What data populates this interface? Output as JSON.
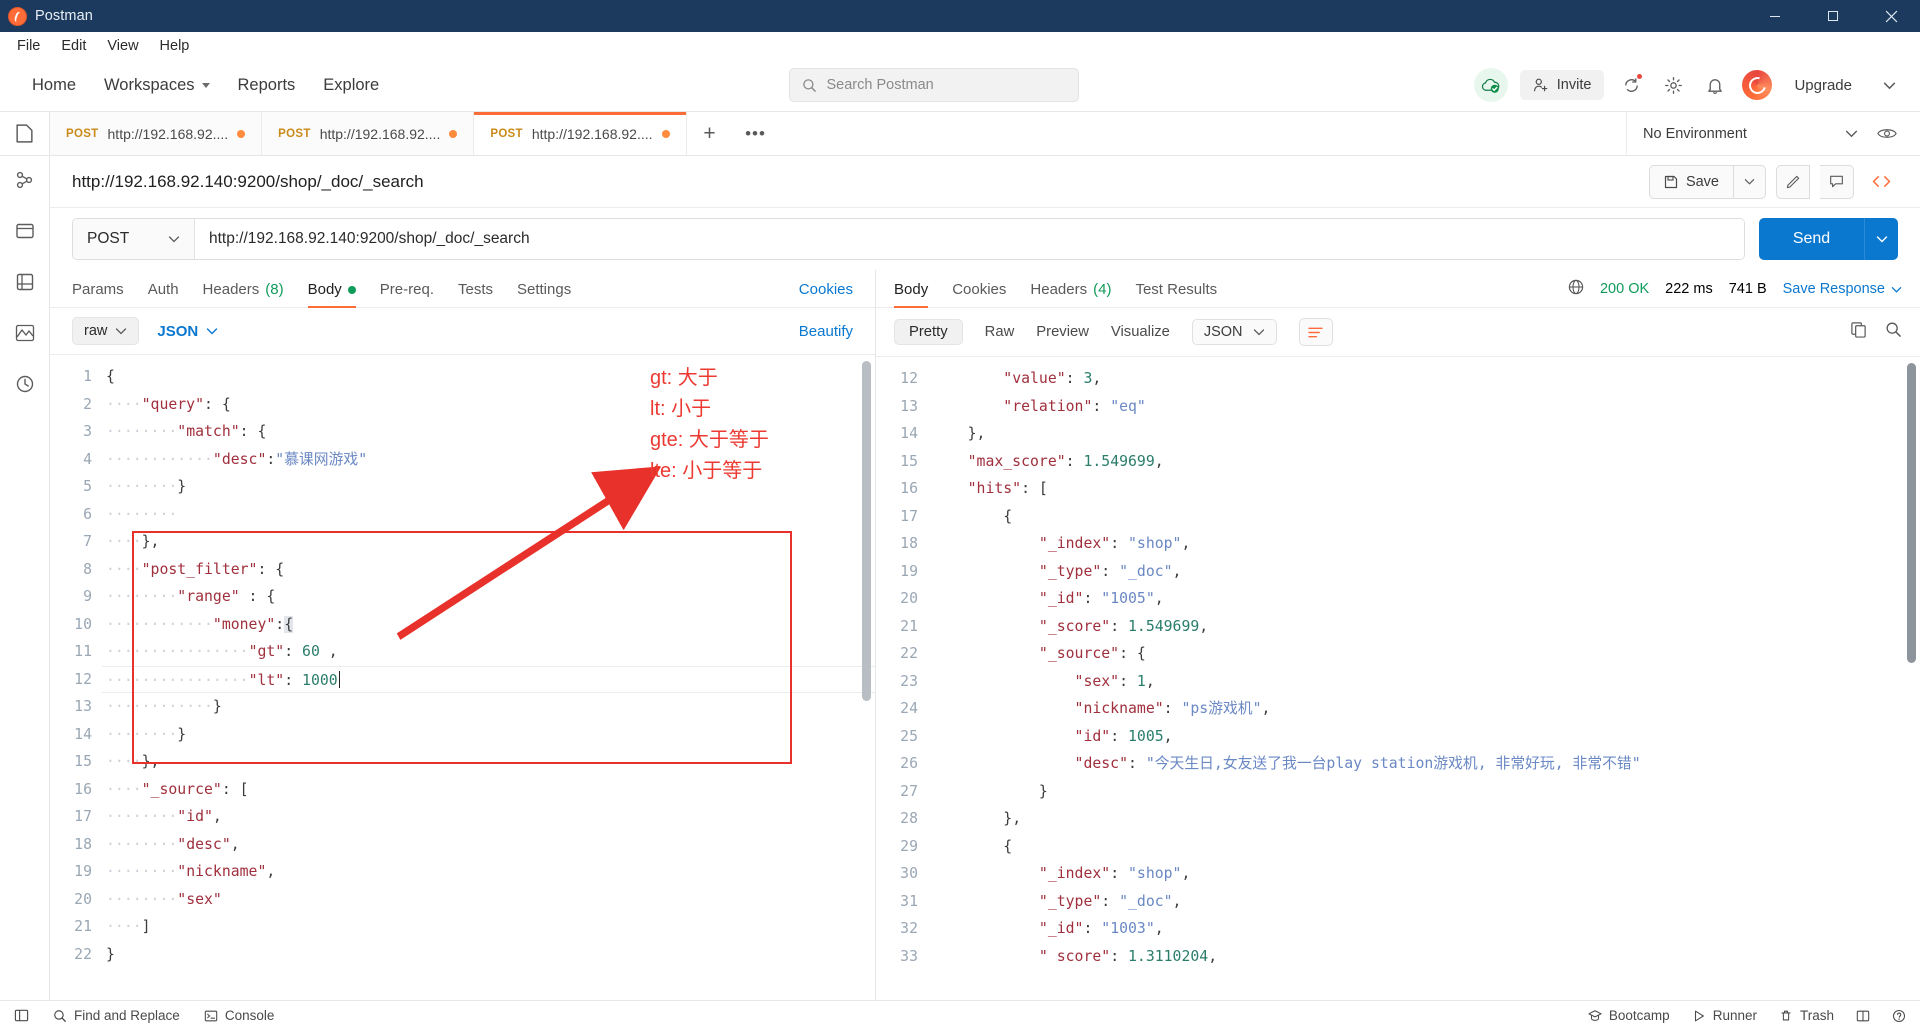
{
  "window": {
    "title": "Postman",
    "minimize": "–",
    "maximize": "☐",
    "close": "✕"
  },
  "menubar": {
    "items": [
      "File",
      "Edit",
      "View",
      "Help"
    ]
  },
  "topnav": {
    "links": [
      "Home",
      "Workspaces",
      "Reports",
      "Explore"
    ],
    "search_placeholder": "Search Postman",
    "invite_label": "Invite",
    "upgrade_label": "Upgrade"
  },
  "tabstrip": {
    "tabs": [
      {
        "method": "POST",
        "url": "http://192.168.92....",
        "active": false
      },
      {
        "method": "POST",
        "url": "http://192.168.92....",
        "active": false
      },
      {
        "method": "POST",
        "url": "http://192.168.92....",
        "active": true
      }
    ],
    "new_tab": "+",
    "more": "•••",
    "environment": "No Environment"
  },
  "request": {
    "title": "http://192.168.92.140:9200/shop/_doc/_search",
    "save_label": "Save",
    "method": "POST",
    "url": "http://192.168.92.140:9200/shop/_doc/_search",
    "send_label": "Send",
    "tabs": [
      {
        "label": "Params"
      },
      {
        "label": "Auth"
      },
      {
        "label": "Headers",
        "count": "(8)"
      },
      {
        "label": "Body",
        "dot": true,
        "active": true
      },
      {
        "label": "Pre-req."
      },
      {
        "label": "Tests"
      },
      {
        "label": "Settings"
      }
    ],
    "cookies_link": "Cookies",
    "body_mode": "raw",
    "body_language": "JSON",
    "beautify_label": "Beautify"
  },
  "editor": {
    "lines": [
      {
        "n": "1",
        "segs": [
          {
            "t": "{",
            "c": "p"
          }
        ]
      },
      {
        "n": "2",
        "segs": [
          {
            "t": "····",
            "c": "dots"
          },
          {
            "t": "\"query\"",
            "c": "k"
          },
          {
            "t": ": {",
            "c": "p"
          }
        ]
      },
      {
        "n": "3",
        "segs": [
          {
            "t": "····",
            "c": "dots"
          },
          {
            "t": "····",
            "c": "dots"
          },
          {
            "t": "\"match\"",
            "c": "k"
          },
          {
            "t": ": {",
            "c": "p"
          }
        ]
      },
      {
        "n": "4",
        "segs": [
          {
            "t": "····",
            "c": "dots"
          },
          {
            "t": "····",
            "c": "dots"
          },
          {
            "t": "····",
            "c": "dots"
          },
          {
            "t": "\"desc\"",
            "c": "k"
          },
          {
            "t": ":",
            "c": "p"
          },
          {
            "t": "\"慕课网游戏\"",
            "c": "str"
          }
        ]
      },
      {
        "n": "5",
        "segs": [
          {
            "t": "····",
            "c": "dots"
          },
          {
            "t": "····",
            "c": "dots"
          },
          {
            "t": "}",
            "c": "p"
          }
        ]
      },
      {
        "n": "6",
        "segs": [
          {
            "t": "····",
            "c": "dots"
          },
          {
            "t": "····",
            "c": "dots"
          }
        ]
      },
      {
        "n": "7",
        "segs": [
          {
            "t": "····",
            "c": "dots"
          },
          {
            "t": "},",
            "c": "p"
          }
        ]
      },
      {
        "n": "8",
        "segs": [
          {
            "t": "····",
            "c": "dots"
          },
          {
            "t": "\"post_filter\"",
            "c": "k"
          },
          {
            "t": ": {",
            "c": "p"
          }
        ]
      },
      {
        "n": "9",
        "segs": [
          {
            "t": "····",
            "c": "dots"
          },
          {
            "t": "····",
            "c": "dots"
          },
          {
            "t": "\"range\"",
            "c": "k"
          },
          {
            "t": " : {",
            "c": "p"
          }
        ]
      },
      {
        "n": "10",
        "segs": [
          {
            "t": "····",
            "c": "dots"
          },
          {
            "t": "····",
            "c": "dots"
          },
          {
            "t": "····",
            "c": "dots"
          },
          {
            "t": "\"money\"",
            "c": "k"
          },
          {
            "t": ":",
            "c": "p"
          },
          {
            "t": "{",
            "c": "hl"
          }
        ]
      },
      {
        "n": "11",
        "segs": [
          {
            "t": "····",
            "c": "dots"
          },
          {
            "t": "····",
            "c": "dots"
          },
          {
            "t": "····",
            "c": "dots"
          },
          {
            "t": "····",
            "c": "dots"
          },
          {
            "t": "\"gt\"",
            "c": "k"
          },
          {
            "t": ": ",
            "c": "p"
          },
          {
            "t": "60",
            "c": "num"
          },
          {
            "t": " ,",
            "c": "p"
          }
        ]
      },
      {
        "n": "12",
        "segs": [
          {
            "t": "····",
            "c": "dots"
          },
          {
            "t": "····",
            "c": "dots"
          },
          {
            "t": "····",
            "c": "dots"
          },
          {
            "t": "····",
            "c": "dots"
          },
          {
            "t": "\"lt\"",
            "c": "k"
          },
          {
            "t": ": ",
            "c": "p"
          },
          {
            "t": "1000",
            "c": "num"
          }
        ],
        "caret": true,
        "current": true
      },
      {
        "n": "13",
        "segs": [
          {
            "t": "····",
            "c": "dots"
          },
          {
            "t": "····",
            "c": "dots"
          },
          {
            "t": "····",
            "c": "dots"
          },
          {
            "t": "}",
            "c": "p"
          }
        ]
      },
      {
        "n": "14",
        "segs": [
          {
            "t": "····",
            "c": "dots"
          },
          {
            "t": "····",
            "c": "dots"
          },
          {
            "t": "}",
            "c": "p"
          }
        ]
      },
      {
        "n": "15",
        "segs": [
          {
            "t": "····",
            "c": "dots"
          },
          {
            "t": "},",
            "c": "p"
          }
        ]
      },
      {
        "n": "16",
        "segs": [
          {
            "t": "····",
            "c": "dots"
          },
          {
            "t": "\"_source\"",
            "c": "k"
          },
          {
            "t": ": [",
            "c": "p"
          }
        ]
      },
      {
        "n": "17",
        "segs": [
          {
            "t": "····",
            "c": "dots"
          },
          {
            "t": "····",
            "c": "dots"
          },
          {
            "t": "\"id\"",
            "c": "k"
          },
          {
            "t": ",",
            "c": "p"
          }
        ]
      },
      {
        "n": "18",
        "segs": [
          {
            "t": "····",
            "c": "dots"
          },
          {
            "t": "····",
            "c": "dots"
          },
          {
            "t": "\"desc\"",
            "c": "k"
          },
          {
            "t": ",",
            "c": "p"
          }
        ]
      },
      {
        "n": "19",
        "segs": [
          {
            "t": "····",
            "c": "dots"
          },
          {
            "t": "····",
            "c": "dots"
          },
          {
            "t": "\"nickname\"",
            "c": "k"
          },
          {
            "t": ",",
            "c": "p"
          }
        ]
      },
      {
        "n": "20",
        "segs": [
          {
            "t": "····",
            "c": "dots"
          },
          {
            "t": "····",
            "c": "dots"
          },
          {
            "t": "\"sex\"",
            "c": "k"
          }
        ]
      },
      {
        "n": "21",
        "segs": [
          {
            "t": "····",
            "c": "dots"
          },
          {
            "t": "]",
            "c": "p"
          }
        ]
      },
      {
        "n": "22",
        "segs": [
          {
            "t": "}",
            "c": "p"
          }
        ]
      }
    ],
    "annotation": "gt: 大于\nlt: 小于\ngte: 大于等于\nlte: 小于等于",
    "annotation_color": "#ec3a33",
    "highlight_box_color": "#e8312a"
  },
  "response": {
    "tabs": [
      {
        "label": "Body",
        "active": true
      },
      {
        "label": "Cookies"
      },
      {
        "label": "Headers",
        "count": "(4)"
      },
      {
        "label": "Test Results"
      }
    ],
    "status": "200 OK",
    "time": "222 ms",
    "size": "741 B",
    "save_response": "Save Response",
    "view_modes": [
      "Pretty",
      "Raw",
      "Preview",
      "Visualize"
    ],
    "active_view": "Pretty",
    "format": "JSON",
    "lines": [
      {
        "n": "12",
        "segs": [
          {
            "t": "        ",
            "c": "p"
          },
          {
            "t": "\"value\"",
            "c": "k"
          },
          {
            "t": ": ",
            "c": "p"
          },
          {
            "t": "3",
            "c": "num"
          },
          {
            "t": ",",
            "c": "p"
          }
        ]
      },
      {
        "n": "13",
        "segs": [
          {
            "t": "        ",
            "c": "p"
          },
          {
            "t": "\"relation\"",
            "c": "k"
          },
          {
            "t": ": ",
            "c": "p"
          },
          {
            "t": "\"eq\"",
            "c": "str"
          }
        ]
      },
      {
        "n": "14",
        "segs": [
          {
            "t": "    ",
            "c": "p"
          },
          {
            "t": "},",
            "c": "p"
          }
        ]
      },
      {
        "n": "15",
        "segs": [
          {
            "t": "    ",
            "c": "p"
          },
          {
            "t": "\"max_score\"",
            "c": "k"
          },
          {
            "t": ": ",
            "c": "p"
          },
          {
            "t": "1.549699",
            "c": "num"
          },
          {
            "t": ",",
            "c": "p"
          }
        ]
      },
      {
        "n": "16",
        "segs": [
          {
            "t": "    ",
            "c": "p"
          },
          {
            "t": "\"hits\"",
            "c": "k"
          },
          {
            "t": ": [",
            "c": "p"
          }
        ]
      },
      {
        "n": "17",
        "segs": [
          {
            "t": "        ",
            "c": "p"
          },
          {
            "t": "{",
            "c": "p"
          }
        ]
      },
      {
        "n": "18",
        "segs": [
          {
            "t": "            ",
            "c": "p"
          },
          {
            "t": "\"_index\"",
            "c": "k"
          },
          {
            "t": ": ",
            "c": "p"
          },
          {
            "t": "\"shop\"",
            "c": "str"
          },
          {
            "t": ",",
            "c": "p"
          }
        ]
      },
      {
        "n": "19",
        "segs": [
          {
            "t": "            ",
            "c": "p"
          },
          {
            "t": "\"_type\"",
            "c": "k"
          },
          {
            "t": ": ",
            "c": "p"
          },
          {
            "t": "\"_doc\"",
            "c": "str"
          },
          {
            "t": ",",
            "c": "p"
          }
        ]
      },
      {
        "n": "20",
        "segs": [
          {
            "t": "            ",
            "c": "p"
          },
          {
            "t": "\"_id\"",
            "c": "k"
          },
          {
            "t": ": ",
            "c": "p"
          },
          {
            "t": "\"1005\"",
            "c": "str"
          },
          {
            "t": ",",
            "c": "p"
          }
        ]
      },
      {
        "n": "21",
        "segs": [
          {
            "t": "            ",
            "c": "p"
          },
          {
            "t": "\"_score\"",
            "c": "k"
          },
          {
            "t": ": ",
            "c": "p"
          },
          {
            "t": "1.549699",
            "c": "num"
          },
          {
            "t": ",",
            "c": "p"
          }
        ]
      },
      {
        "n": "22",
        "segs": [
          {
            "t": "            ",
            "c": "p"
          },
          {
            "t": "\"_source\"",
            "c": "k"
          },
          {
            "t": ": {",
            "c": "p"
          }
        ]
      },
      {
        "n": "23",
        "segs": [
          {
            "t": "                ",
            "c": "p"
          },
          {
            "t": "\"sex\"",
            "c": "k"
          },
          {
            "t": ": ",
            "c": "p"
          },
          {
            "t": "1",
            "c": "num"
          },
          {
            "t": ",",
            "c": "p"
          }
        ]
      },
      {
        "n": "24",
        "segs": [
          {
            "t": "                ",
            "c": "p"
          },
          {
            "t": "\"nickname\"",
            "c": "k"
          },
          {
            "t": ": ",
            "c": "p"
          },
          {
            "t": "\"ps游戏机\"",
            "c": "str"
          },
          {
            "t": ",",
            "c": "p"
          }
        ]
      },
      {
        "n": "25",
        "segs": [
          {
            "t": "                ",
            "c": "p"
          },
          {
            "t": "\"id\"",
            "c": "k"
          },
          {
            "t": ": ",
            "c": "p"
          },
          {
            "t": "1005",
            "c": "num"
          },
          {
            "t": ",",
            "c": "p"
          }
        ]
      },
      {
        "n": "26",
        "segs": [
          {
            "t": "                ",
            "c": "p"
          },
          {
            "t": "\"desc\"",
            "c": "k"
          },
          {
            "t": ": ",
            "c": "p"
          },
          {
            "t": "\"今天生日,女友送了我一台play station游戏机, 非常好玩, 非常不错\"",
            "c": "str"
          }
        ]
      },
      {
        "n": "27",
        "segs": [
          {
            "t": "            ",
            "c": "p"
          },
          {
            "t": "}",
            "c": "p"
          }
        ]
      },
      {
        "n": "28",
        "segs": [
          {
            "t": "        ",
            "c": "p"
          },
          {
            "t": "},",
            "c": "p"
          }
        ]
      },
      {
        "n": "29",
        "segs": [
          {
            "t": "        ",
            "c": "p"
          },
          {
            "t": "{",
            "c": "p"
          }
        ]
      },
      {
        "n": "30",
        "segs": [
          {
            "t": "            ",
            "c": "p"
          },
          {
            "t": "\"_index\"",
            "c": "k"
          },
          {
            "t": ": ",
            "c": "p"
          },
          {
            "t": "\"shop\"",
            "c": "str"
          },
          {
            "t": ",",
            "c": "p"
          }
        ]
      },
      {
        "n": "31",
        "segs": [
          {
            "t": "            ",
            "c": "p"
          },
          {
            "t": "\"_type\"",
            "c": "k"
          },
          {
            "t": ": ",
            "c": "p"
          },
          {
            "t": "\"_doc\"",
            "c": "str"
          },
          {
            "t": ",",
            "c": "p"
          }
        ]
      },
      {
        "n": "32",
        "segs": [
          {
            "t": "            ",
            "c": "p"
          },
          {
            "t": "\"_id\"",
            "c": "k"
          },
          {
            "t": ": ",
            "c": "p"
          },
          {
            "t": "\"1003\"",
            "c": "str"
          },
          {
            "t": ",",
            "c": "p"
          }
        ]
      },
      {
        "n": "33",
        "segs": [
          {
            "t": "            ",
            "c": "p"
          },
          {
            "t": "\" score\"",
            "c": "k"
          },
          {
            "t": ": ",
            "c": "p"
          },
          {
            "t": "1.3110204",
            "c": "num"
          },
          {
            "t": ",",
            "c": "p"
          }
        ]
      }
    ]
  },
  "footer": {
    "left": [
      "Find and Replace",
      "Console"
    ],
    "right": [
      "Bootcamp",
      "Runner",
      "Trash"
    ]
  },
  "colors": {
    "accent": "#ff6c37",
    "blue": "#0b78d0",
    "green": "#0f9b5a",
    "titlebar": "#1c3a5e"
  }
}
